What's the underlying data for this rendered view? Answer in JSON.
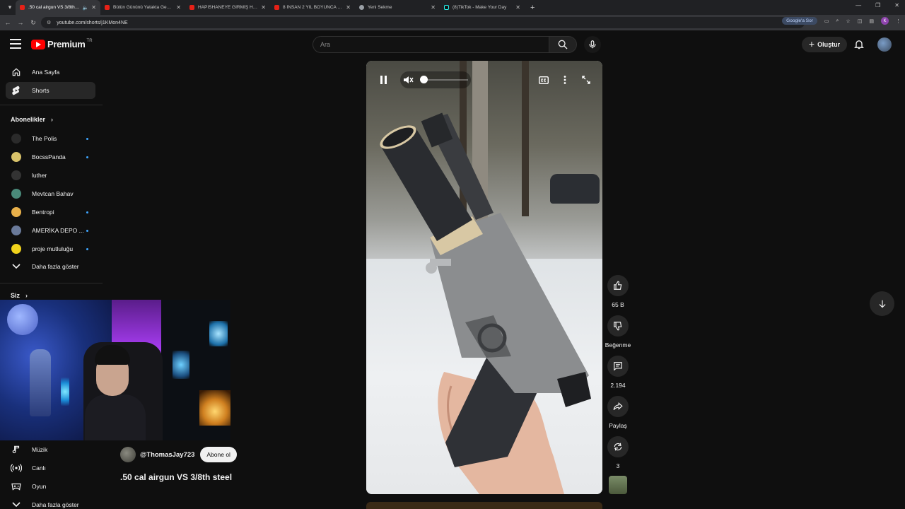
{
  "browser": {
    "tabs": [
      {
        "label": ".50 cal airgun VS 3/8th stee",
        "active": true,
        "icon": "youtube",
        "muted_icon": "speaker-icon"
      },
      {
        "label": "Bütün Gününü Yatakta Geçiriyo",
        "icon": "youtube"
      },
      {
        "label": "HAPİSHANEYE GİRMİŞ HANIM",
        "icon": "youtube"
      },
      {
        "label": "8 İNSAN 2 YIL BOYUNCA BİR P",
        "icon": "youtube"
      },
      {
        "label": "Yeni Sekme",
        "icon": "globe"
      },
      {
        "label": "(8)TikTok - Make Your Day",
        "icon": "tiktok"
      }
    ],
    "url": "youtube.com/shorts/j1KMon4NE",
    "google_ask": "Google'a Sor",
    "profile_initial": "K"
  },
  "header": {
    "logo_text": "Premium",
    "region": "TR",
    "search_placeholder": "Ara",
    "create_label": "Oluştur"
  },
  "sidebar": {
    "main": [
      {
        "label": "Ana Sayfa",
        "icon": "home-icon"
      },
      {
        "label": "Shorts",
        "icon": "shorts-icon",
        "active": true
      }
    ],
    "subscriptions_title": "Abonelikler",
    "subscriptions": [
      {
        "label": "The Polis",
        "dot": true,
        "color": "#2b2b2b"
      },
      {
        "label": "BocssPanda",
        "dot": true,
        "color": "#d9c36a"
      },
      {
        "label": "luther",
        "dot": false,
        "color": "#333333"
      },
      {
        "label": "Mevtcan Bahav",
        "dot": false,
        "color": "#4a8a7a"
      },
      {
        "label": "Bentropi",
        "dot": true,
        "color": "#e8b04a"
      },
      {
        "label": "AMERİKA DEPO ...",
        "dot": true,
        "color": "#6a7a9a"
      },
      {
        "label": "proje mutluluğu",
        "dot": true,
        "color": "#f1d31c"
      }
    ],
    "show_more": "Daha fazla göster",
    "you_title": "Siz",
    "explore": [
      {
        "label": "Müzik",
        "icon": "music-icon"
      },
      {
        "label": "Canlı",
        "icon": "live-icon"
      },
      {
        "label": "Oyun",
        "icon": "gaming-icon"
      }
    ],
    "show_more_2": "Daha fazla göster"
  },
  "video": {
    "channel": "@ThomasJay723",
    "subscribe_label": "Abone ol",
    "title": ".50 cal airgun VS 3/8th steel",
    "volume_fraction": 0.0
  },
  "actions": {
    "likes": "65 B",
    "dislike_label": "Beğenme",
    "comments": "2.194",
    "share_label": "Paylaş",
    "remix_count": "3"
  }
}
